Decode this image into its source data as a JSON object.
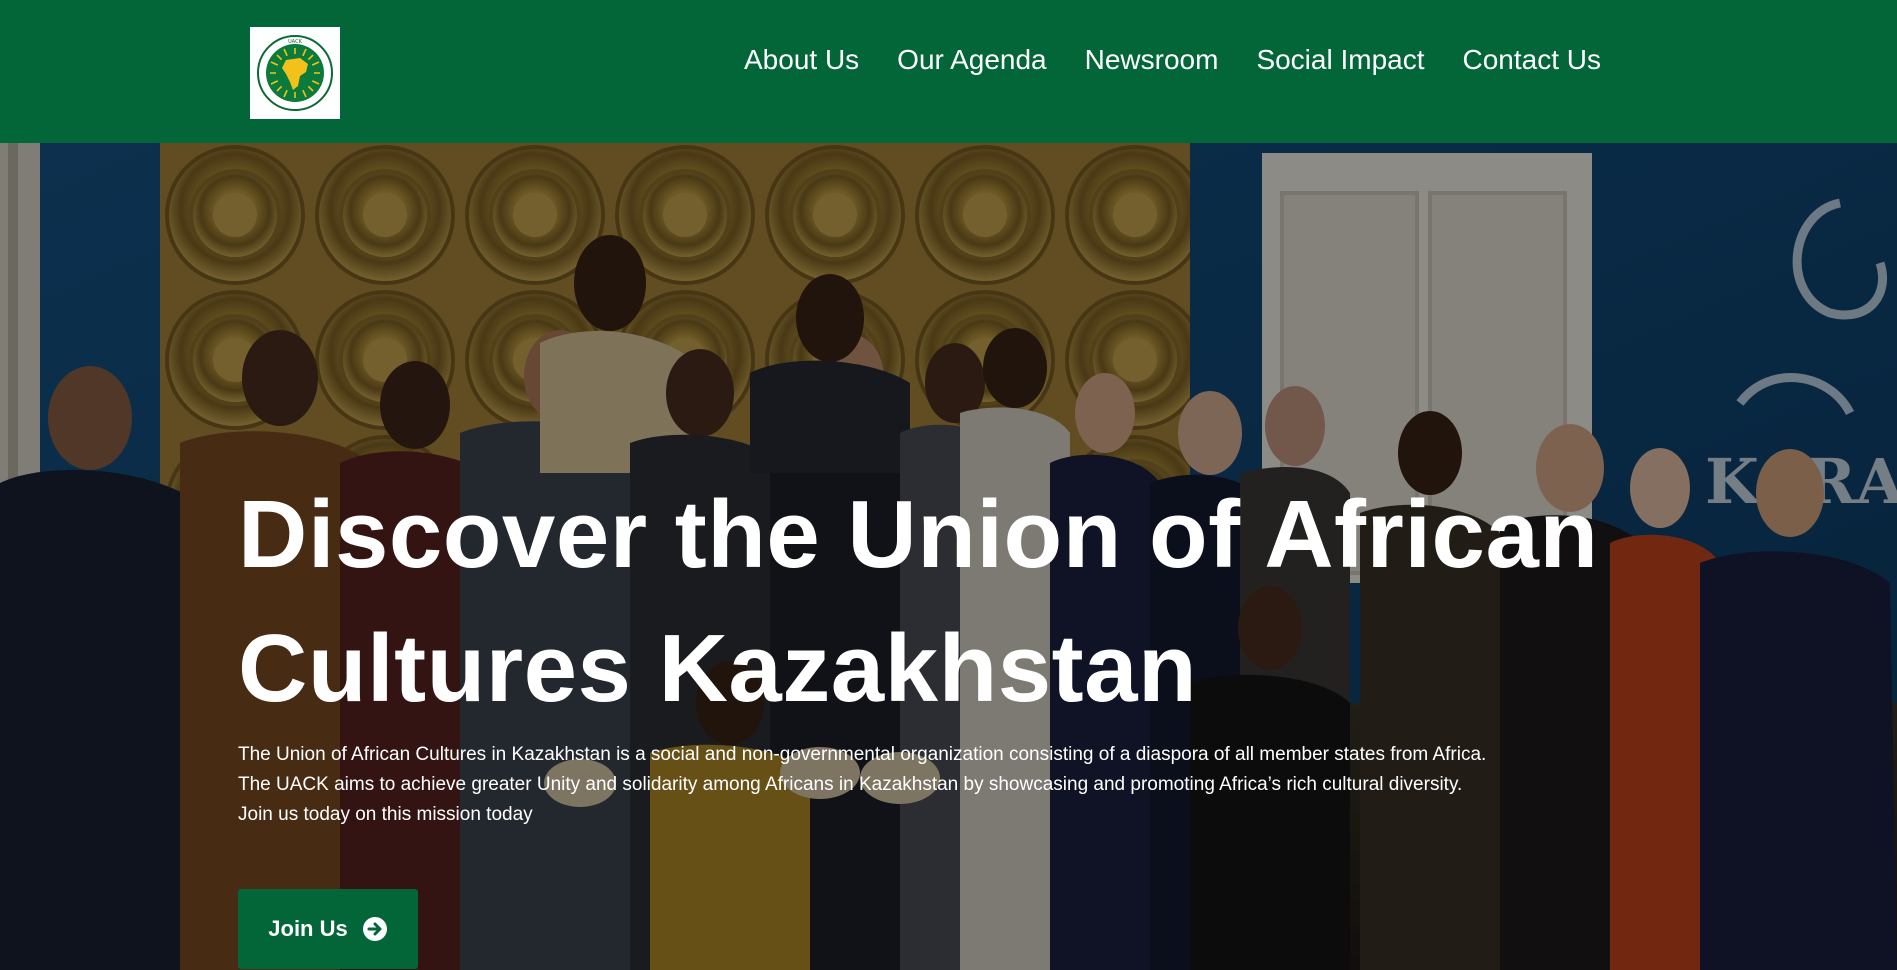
{
  "header": {
    "logo_text": "UNION OF AFRICAN CULTURES IN KAZAKHSTAN",
    "nav": [
      {
        "label": "About Us"
      },
      {
        "label": "Our Agenda"
      },
      {
        "label": "Newsroom"
      },
      {
        "label": "Social Impact"
      },
      {
        "label": "Contact Us"
      }
    ]
  },
  "hero": {
    "title_line1": "Discover the Union of African",
    "title_line2": "Cultures Kazakhstan",
    "description": [
      "The  Union of African Cultures in Kazakhstan is a social and non-governmental organization consisting of a diaspora of all member states from Africa.",
      "The UACK aims to achieve greater Unity and solidarity among Africans in Kazakhstan by showcasing and promoting Africa’s rich cultural diversity.",
      "Join us today on this mission today"
    ],
    "cta_label": "Join Us",
    "cta_icon": "arrow-circle-right-icon",
    "wall_sign_text": "KARA"
  },
  "colors": {
    "brand_green": "#036639",
    "text": "#ffffff",
    "wall_blue": "#0f3f6e",
    "panel_gold": "#b8963f"
  }
}
